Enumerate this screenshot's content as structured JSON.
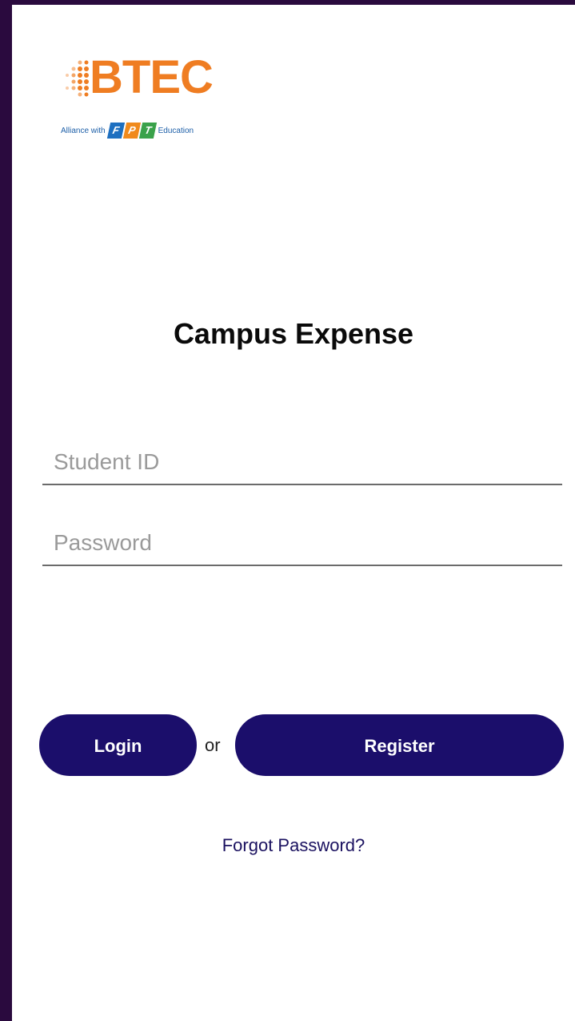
{
  "logo": {
    "brand": "BTEC",
    "alliance_text": "Alliance with",
    "partner_letters": [
      "F",
      "P",
      "T"
    ],
    "education_text": "Education",
    "colors": {
      "brand": "#ef7d22",
      "f": "#1d6fc0",
      "p": "#f08a1c",
      "t": "#3aa24a"
    }
  },
  "app_title": "Campus Expense",
  "form": {
    "student_id": {
      "placeholder": "Student ID",
      "value": ""
    },
    "password": {
      "placeholder": "Password",
      "value": ""
    }
  },
  "actions": {
    "login_label": "Login",
    "or_label": "or",
    "register_label": "Register",
    "forgot_label": "Forgot Password?"
  },
  "theme": {
    "primary": "#1b0e6b",
    "frame": "#2a0a3e"
  }
}
